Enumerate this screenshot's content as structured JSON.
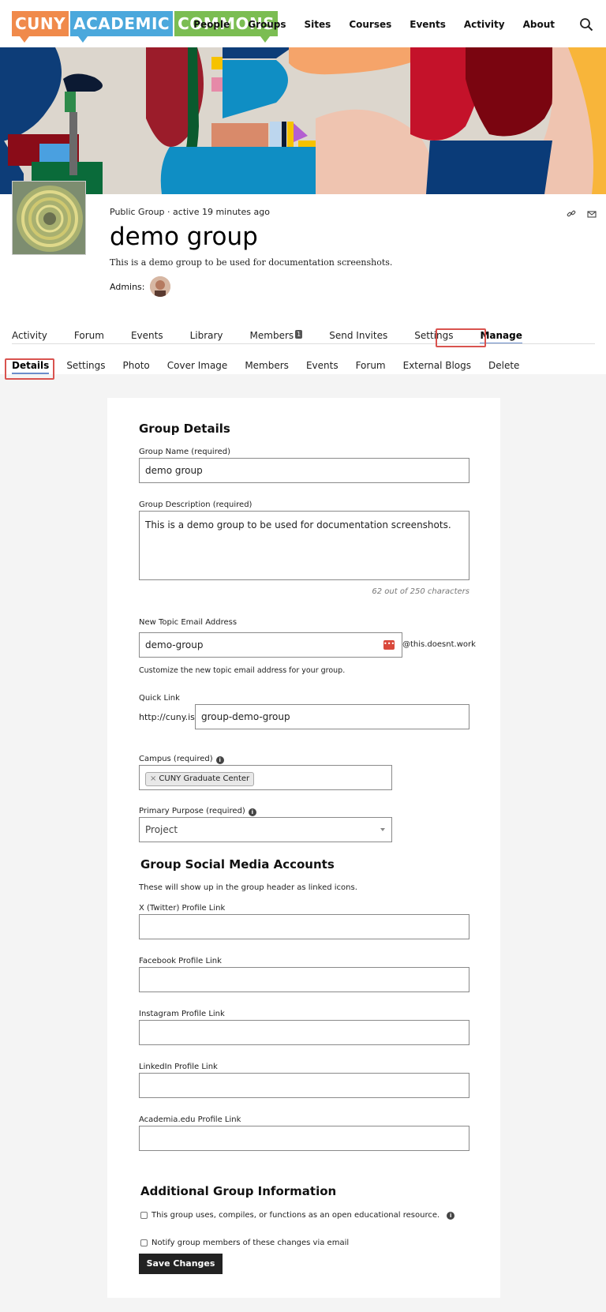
{
  "header": {
    "logo": [
      "CUNY",
      "ACADEMIC",
      "COMMONS"
    ],
    "nav": [
      "People",
      "Groups",
      "Sites",
      "Courses",
      "Events",
      "Activity",
      "About"
    ]
  },
  "group": {
    "meta": "Public Group · active 19 minutes ago",
    "title": "demo group",
    "description": "This is a demo group to be used for documentation screenshots.",
    "admins_label": "Admins:"
  },
  "tabs": {
    "items": [
      "Activity",
      "Forum",
      "Events",
      "Library",
      "Members",
      "Send Invites",
      "Settings",
      "Manage"
    ],
    "members_count": "1",
    "active": "Manage"
  },
  "subtabs": {
    "items": [
      "Details",
      "Settings",
      "Photo",
      "Cover Image",
      "Members",
      "Events",
      "Forum",
      "External Blogs",
      "Delete"
    ],
    "active": "Details"
  },
  "form": {
    "details_heading": "Group Details",
    "name_label": "Group Name (required)",
    "name_value": "demo group",
    "desc_label": "Group Description (required)",
    "desc_value": "This is a demo group to be used for documentation screenshots.",
    "char_count": "62 out of 250 characters",
    "email_label": "New Topic Email Address",
    "email_value": "demo-group",
    "email_suffix": "@this.doesnt.work",
    "email_note": "Customize the new topic email address for your group.",
    "quicklink_label": "Quick Link",
    "quicklink_prefix": "http://cuny.is/",
    "quicklink_value": "group-demo-group",
    "campus_label": "Campus (required)",
    "campus_chip": "CUNY Graduate Center",
    "purpose_label": "Primary Purpose (required)",
    "purpose_value": "Project",
    "social_heading": "Group Social Media Accounts",
    "social_note": "These will show up in the group header as linked icons.",
    "twitter_label": "X (Twitter) Profile Link",
    "facebook_label": "Facebook Profile Link",
    "instagram_label": "Instagram Profile Link",
    "linkedin_label": "LinkedIn Profile Link",
    "academia_label": "Academia.edu Profile Link",
    "additional_heading": "Additional Group Information",
    "oer_label": "This group uses, compiles, or functions as an open educational resource.",
    "notify_label": "Notify group members of these changes via email",
    "save_label": "Save Changes"
  },
  "colors": {
    "accent_underline": "#6b8dcb",
    "highlight_box": "#d9534f",
    "button": "#222222"
  }
}
